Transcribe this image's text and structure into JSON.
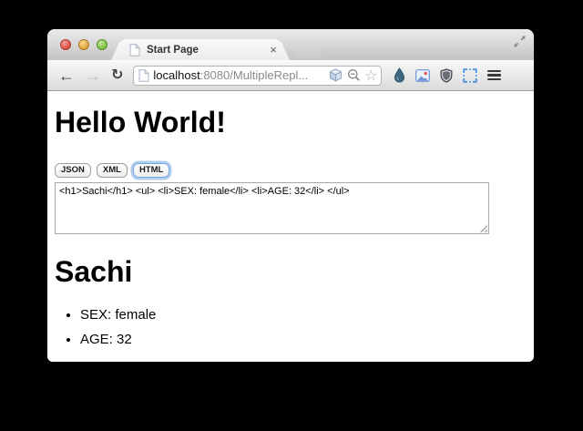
{
  "browser": {
    "tab_title": "Start Page",
    "tab_close_glyph": "×",
    "url": {
      "host": "localhost",
      "rest": ":8080/MultipleRepl..."
    },
    "icons": {
      "back": "←",
      "forward": "→",
      "reload": "↻",
      "star": "☆"
    }
  },
  "colors": {
    "traffic_red": "#dd4f44",
    "traffic_yellow": "#e0a33c",
    "traffic_green": "#7cc03f",
    "focus_ring": "#74a7e0",
    "accent_blue": "#4e94dc"
  },
  "page": {
    "title": "Hello World!",
    "format_buttons": [
      {
        "label": "JSON",
        "focused": false
      },
      {
        "label": "XML",
        "focused": false
      },
      {
        "label": "HTML",
        "focused": true
      }
    ],
    "textarea_value": "<h1>Sachi</h1> <ul> <li>SEX: female</li> <li>AGE: 32</li> </ul>",
    "result_heading": "Sachi",
    "result_list": [
      "SEX: female",
      "AGE: 32"
    ]
  }
}
